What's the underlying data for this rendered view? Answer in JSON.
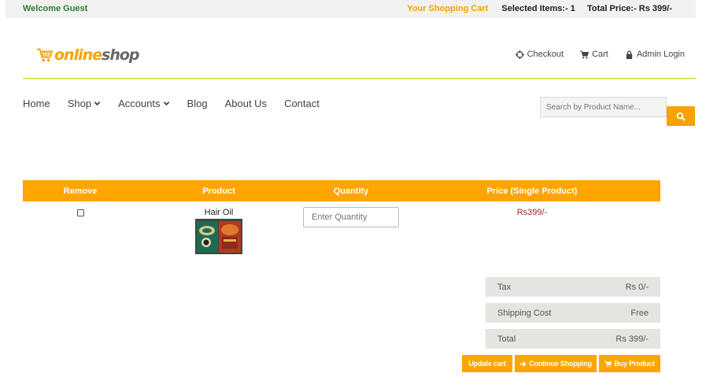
{
  "topbar": {
    "welcome": "Welcome Guest",
    "your_cart": "Your Shopping Cart",
    "selected_items": "Selected Items:- 1",
    "total_price": "Total Price:- Rs 399/-"
  },
  "brand": {
    "part1": "online",
    "part2": "shop",
    "icon": "shopping-cart-logo-icon"
  },
  "header_links": {
    "checkout": "Checkout",
    "cart": "Cart",
    "admin_login": "Admin Login"
  },
  "nav": {
    "home": "Home",
    "shop": "Shop",
    "accounts": "Accounts",
    "blog": "Blog",
    "about": "About Us",
    "contact": "Contact"
  },
  "search": {
    "placeholder": "Search by Product Name..."
  },
  "cart_table": {
    "headers": {
      "remove": "Remove",
      "product": "Product",
      "quantity": "Quantity",
      "price": "Price (Single Product)"
    },
    "rows": [
      {
        "product_name": "Hair Oil",
        "quantity_placeholder": "Enter Quantity",
        "price": "Rs399/-"
      }
    ]
  },
  "summary": {
    "tax_label": "Tax",
    "tax_value": "Rs 0/-",
    "shipping_label": "Shipping Cost",
    "shipping_value": "Free",
    "total_label": "Total",
    "total_value": "Rs 399/-"
  },
  "actions": {
    "update_cart": "Update cart",
    "continue_shopping": "Continue Shopping",
    "buy_product": "Buy Product"
  },
  "colors": {
    "accent": "#ffa500",
    "welcome": "#2e7d32",
    "price": "#a0281e",
    "divider": "#d4c400"
  }
}
